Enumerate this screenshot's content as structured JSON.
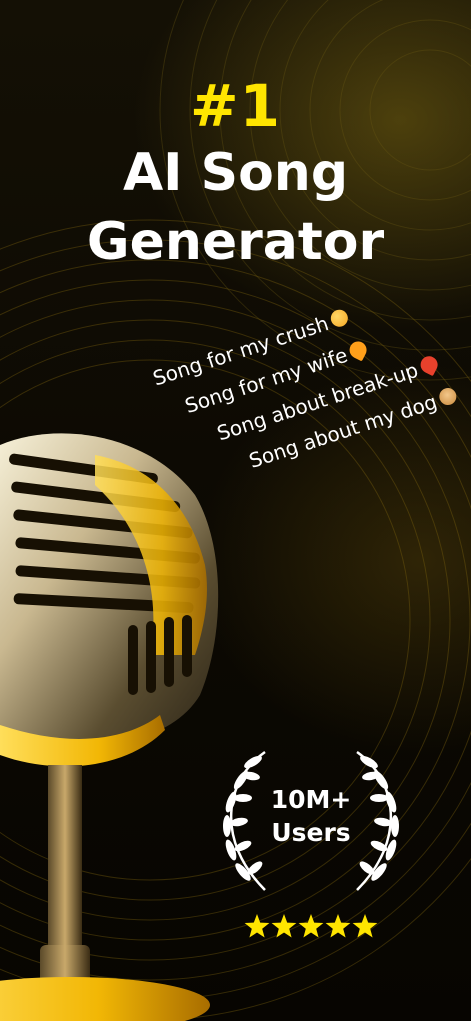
{
  "headline": {
    "rank": "#1",
    "line1": "AI Song",
    "line2": "Generator"
  },
  "prompts": [
    {
      "text": "Song for my crush",
      "emoji": "smiling-heart-eyes-emoji",
      "color": "#F5A623"
    },
    {
      "text": "Song for my wife",
      "emoji": "orange-heart-emoji",
      "color": "#FF9F1A"
    },
    {
      "text": "Song about break-up",
      "emoji": "broken-heart-emoji",
      "color": "#E8412C"
    },
    {
      "text": "Song about my dog",
      "emoji": "dog-face-emoji",
      "color": "#D9A24E"
    }
  ],
  "badge": {
    "count": "10M+",
    "label": "Users",
    "rating": 5,
    "rating_max": 5
  },
  "colors": {
    "accent": "#FFE500",
    "text": "#FFFFFF",
    "mic_gold": "#F2B705"
  }
}
